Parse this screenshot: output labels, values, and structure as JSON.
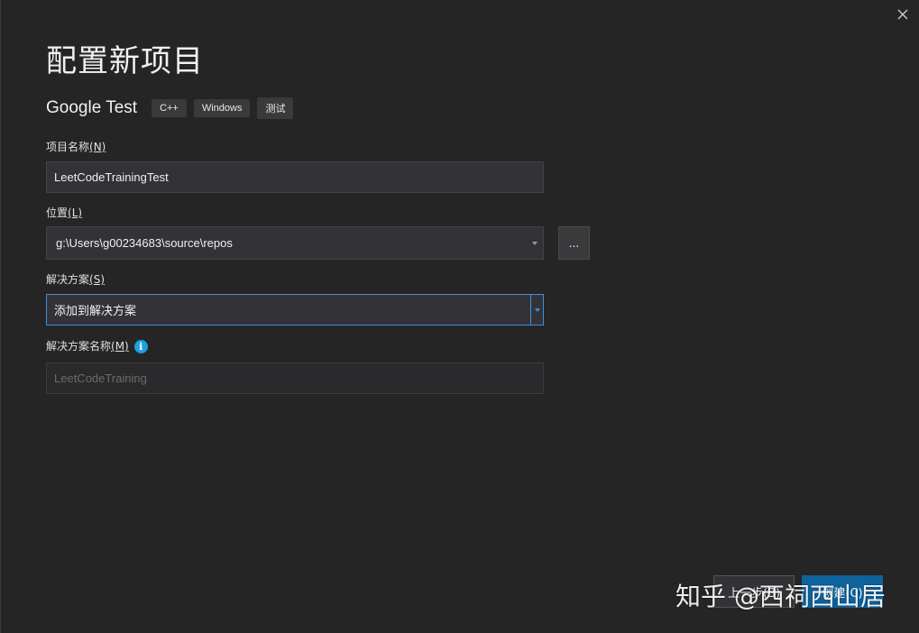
{
  "dialog": {
    "title": "配置新项目",
    "template_name": "Google Test",
    "tags": [
      "C++",
      "Windows",
      "测试"
    ]
  },
  "project_name": {
    "label": "项目名称",
    "accel": "(N)",
    "value": "LeetCodeTrainingTest"
  },
  "location": {
    "label": "位置",
    "accel": "(L)",
    "value": "g:\\Users\\g00234683\\source\\repos",
    "browse_label": "..."
  },
  "solution": {
    "label": "解决方案",
    "accel": "(S)",
    "value": "添加到解决方案"
  },
  "solution_name": {
    "label": "解决方案名称",
    "accel": "(M)",
    "value": "LeetCodeTraining",
    "info_icon": "info-icon"
  },
  "footer": {
    "back_label": "上一步(B)",
    "create_label": "创建(C)"
  },
  "watermark": "知乎 @西祠西山居",
  "colors": {
    "background": "#252526",
    "field": "#333337",
    "accent": "#3e8fd6",
    "info": "#1ba1e2"
  }
}
